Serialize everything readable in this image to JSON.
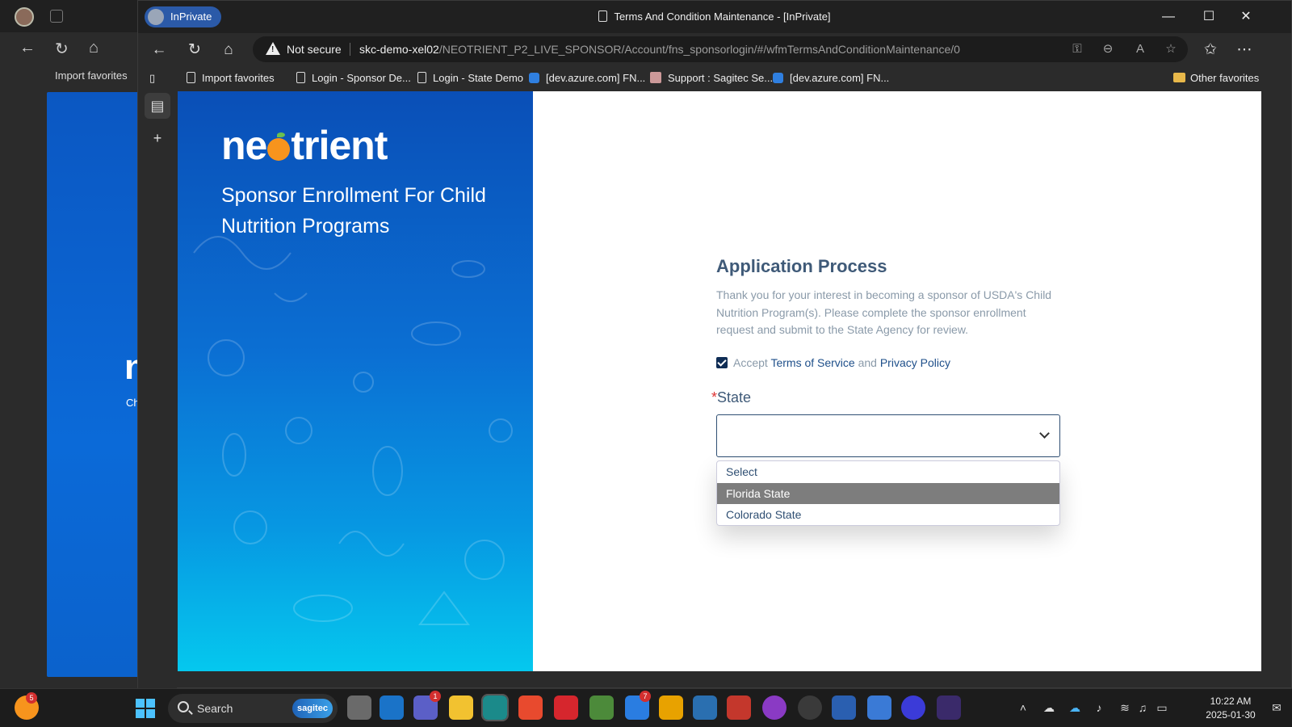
{
  "background_window": {
    "favorite_label": "Import favorites",
    "hero_letter": "n",
    "hero_small": "Ch"
  },
  "window": {
    "inprivate_label": "InPrivate",
    "title": "Terms And Condition Maintenance - [InPrivate]"
  },
  "address_bar": {
    "security_label": "Not secure",
    "url_host": "skc-demo-xel02",
    "url_path": "/NEOTRIENT_P2_LIVE_SPONSOR/Account/fns_sponsorlogin/#/wfmTermsAndConditionMaintenance/0"
  },
  "favorites": [
    {
      "label": "Import favorites",
      "icon": "import-icon"
    },
    {
      "label": "Login - Sponsor De...",
      "icon": "page-icon"
    },
    {
      "label": "Login - State Demo",
      "icon": "page-icon"
    },
    {
      "label": "[dev.azure.com] FN...",
      "icon": "azure-icon"
    },
    {
      "label": "Support : Sagitec Se...",
      "icon": "sagitec-icon"
    },
    {
      "label": "[dev.azure.com] FN...",
      "icon": "azure-icon"
    }
  ],
  "other_favorites": "Other favorites",
  "hero": {
    "logo": {
      "part1": "ne",
      "part2": "trient"
    },
    "tagline": "Sponsor Enrollment For Child Nutrition Programs"
  },
  "form": {
    "heading": "Application Process",
    "intro": "Thank you for your interest in becoming a sponsor of USDA's Child Nutrition Program(s). Please complete the sponsor enrollment request and submit to the State Agency for review.",
    "accept_prefix": "Accept",
    "terms_link": "Terms of Service",
    "and_text": "and",
    "privacy_link": "Privacy Policy",
    "accepted": true,
    "state_required_mark": "*",
    "state_label": "State",
    "state_value": "",
    "state_options": [
      "Select",
      "Florida State",
      "Colorado State"
    ],
    "highlighted_option": "Florida State"
  },
  "taskbar": {
    "search_placeholder": "Search",
    "search_chip": "sagitec",
    "notification_badge": "5",
    "teams_badge": "1",
    "todo_badge": "7",
    "time": "10:22 AM",
    "date": "2025-01-30"
  },
  "colors": {
    "accent": "#3f5a78",
    "link": "#1e4f8a",
    "hero_top": "#0a4fb7",
    "hero_bottom": "#05c8ee",
    "dropdown_highlight": "#7d7d7d"
  }
}
